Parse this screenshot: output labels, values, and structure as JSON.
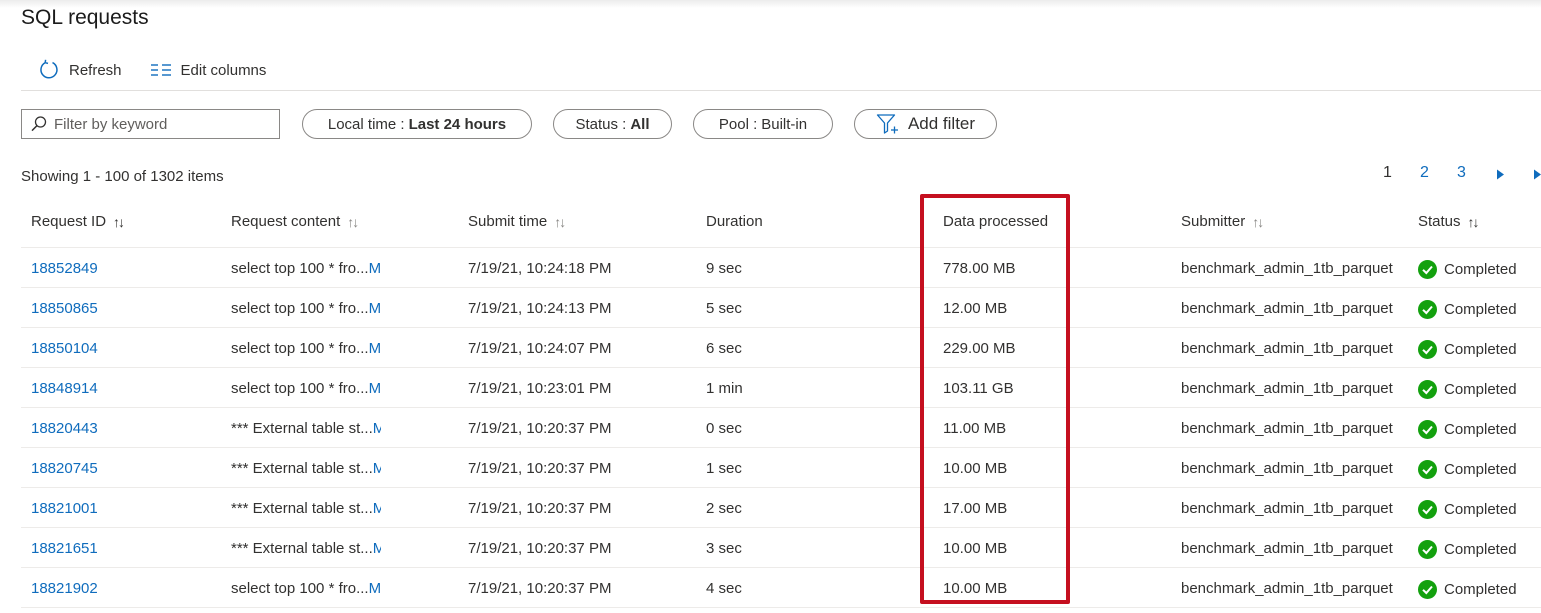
{
  "page": {
    "title": "SQL requests"
  },
  "toolbar": {
    "refresh_label": "Refresh",
    "edit_columns_label": "Edit columns"
  },
  "filters": {
    "search_placeholder": "Filter by keyword",
    "local_time": {
      "label": "Local time :",
      "value": "Last 24 hours"
    },
    "status": {
      "label": "Status :",
      "value": "All"
    },
    "pool": {
      "label": "Pool :",
      "value": "Built-in"
    },
    "add_filter_label": "Add filter"
  },
  "summary": {
    "showing_text": "Showing 1 - 100 of 1302 items"
  },
  "pagination": {
    "pages": [
      "1",
      "2",
      "3"
    ],
    "current": "1"
  },
  "table": {
    "columns": [
      {
        "key": "id",
        "label": "Request ID",
        "sortable": true
      },
      {
        "key": "content",
        "label": "Request content",
        "sortable": true
      },
      {
        "key": "submit",
        "label": "Submit time",
        "sortable": true
      },
      {
        "key": "duration",
        "label": "Duration",
        "sortable": false
      },
      {
        "key": "data",
        "label": "Data processed",
        "sortable": false
      },
      {
        "key": "submitter",
        "label": "Submitter",
        "sortable": true
      },
      {
        "key": "status",
        "label": "Status",
        "sortable": true
      }
    ],
    "more_label": "More",
    "rows": [
      {
        "id": "18852849",
        "content": "select top 100 * fro...",
        "submit": "7/19/21, 10:24:18 PM",
        "duration": "9 sec",
        "data": "778.00 MB",
        "submitter": "benchmark_admin_1tb_parquet",
        "status": "Completed"
      },
      {
        "id": "18850865",
        "content": "select top 100 * fro...",
        "submit": "7/19/21, 10:24:13 PM",
        "duration": "5 sec",
        "data": "12.00 MB",
        "submitter": "benchmark_admin_1tb_parquet",
        "status": "Completed"
      },
      {
        "id": "18850104",
        "content": "select top 100 * fro...",
        "submit": "7/19/21, 10:24:07 PM",
        "duration": "6 sec",
        "data": "229.00 MB",
        "submitter": "benchmark_admin_1tb_parquet",
        "status": "Completed"
      },
      {
        "id": "18848914",
        "content": "select top 100 * fro...",
        "submit": "7/19/21, 10:23:01 PM",
        "duration": "1 min",
        "data": "103.11 GB",
        "submitter": "benchmark_admin_1tb_parquet",
        "status": "Completed"
      },
      {
        "id": "18820443",
        "content": "*** External table st...",
        "submit": "7/19/21, 10:20:37 PM",
        "duration": "0 sec",
        "data": "11.00 MB",
        "submitter": "benchmark_admin_1tb_parquet",
        "status": "Completed"
      },
      {
        "id": "18820745",
        "content": "*** External table st...",
        "submit": "7/19/21, 10:20:37 PM",
        "duration": "1 sec",
        "data": "10.00 MB",
        "submitter": "benchmark_admin_1tb_parquet",
        "status": "Completed"
      },
      {
        "id": "18821001",
        "content": "*** External table st...",
        "submit": "7/19/21, 10:20:37 PM",
        "duration": "2 sec",
        "data": "17.00 MB",
        "submitter": "benchmark_admin_1tb_parquet",
        "status": "Completed"
      },
      {
        "id": "18821651",
        "content": "*** External table st...",
        "submit": "7/19/21, 10:20:37 PM",
        "duration": "3 sec",
        "data": "10.00 MB",
        "submitter": "benchmark_admin_1tb_parquet",
        "status": "Completed"
      },
      {
        "id": "18821902",
        "content": "select top 100 * fro...",
        "submit": "7/19/21, 10:20:37 PM",
        "duration": "4 sec",
        "data": "10.00 MB",
        "submitter": "benchmark_admin_1tb_parquet",
        "status": "Completed"
      }
    ]
  },
  "colors": {
    "link": "#0f6cbd",
    "success": "#13a10e",
    "highlight": "#c50f1f"
  },
  "icons": [
    "refresh-icon",
    "edit-columns-icon",
    "search-icon",
    "filter-icon",
    "chevron-right-icon",
    "check-circle-icon"
  ]
}
